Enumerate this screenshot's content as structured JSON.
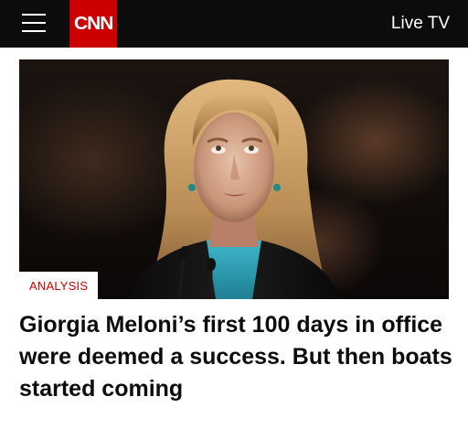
{
  "header": {
    "logo_text": "CNN",
    "live_tv_label": "Live TV",
    "brand_color": "#cc0000",
    "background_color": "#0c0c0c",
    "menu_icon": "hamburger-menu-icon"
  },
  "article": {
    "tag": "ANALYSIS",
    "tag_color": "#cc0000",
    "headline": "Giorgia Meloni’s first 100 days in office were deemed a success. But then boats started coming"
  }
}
